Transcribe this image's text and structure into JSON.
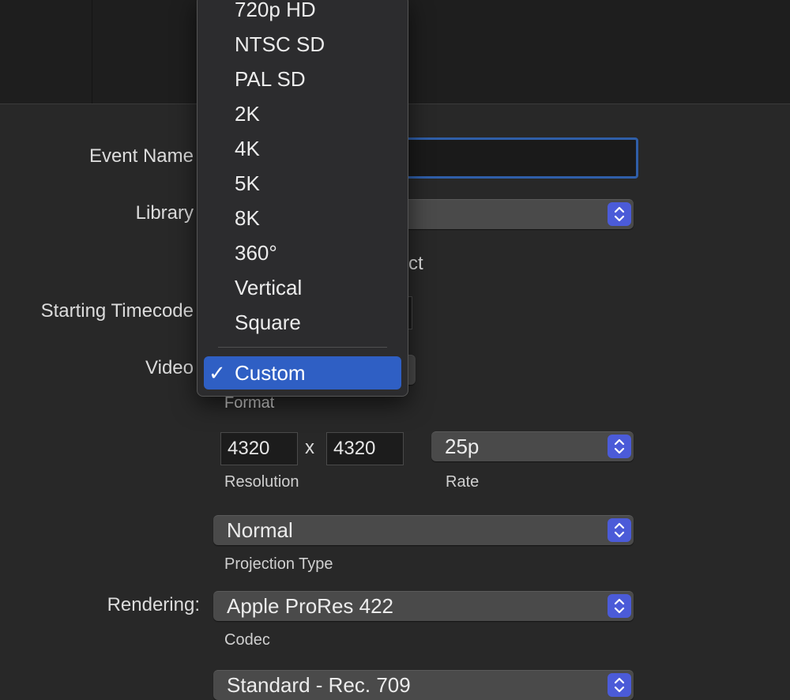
{
  "form": {
    "event_name_label": "Event Name",
    "library_label": "Library",
    "behind_text_fragment": "ct",
    "starting_timecode_label": "Starting Timecode",
    "video_label": "Video",
    "format_sublabel": "Format",
    "resolution_width": "4320",
    "resolution_x": "x",
    "resolution_height": "4320",
    "resolution_sublabel": "Resolution",
    "rate_value": "25p",
    "rate_sublabel": "Rate",
    "projection_value": "Normal",
    "projection_sublabel": "Projection Type",
    "rendering_label": "Rendering:",
    "codec_value": "Apple ProRes 422",
    "codec_sublabel": "Codec",
    "color_space_value": "Standard - Rec. 709"
  },
  "format_menu": {
    "items": [
      "720p HD",
      "NTSC SD",
      "PAL SD",
      "2K",
      "4K",
      "5K",
      "8K",
      "360°",
      "Vertical",
      "Square"
    ],
    "selected": "Custom",
    "check": "✓"
  },
  "colors": {
    "accent": "#2f5fc4",
    "stepper": "#4b5bd8",
    "focus_ring": "#2f5ea8"
  },
  "icons": {
    "stepper": "chevron-up-down-icon",
    "check": "checkmark-icon"
  }
}
